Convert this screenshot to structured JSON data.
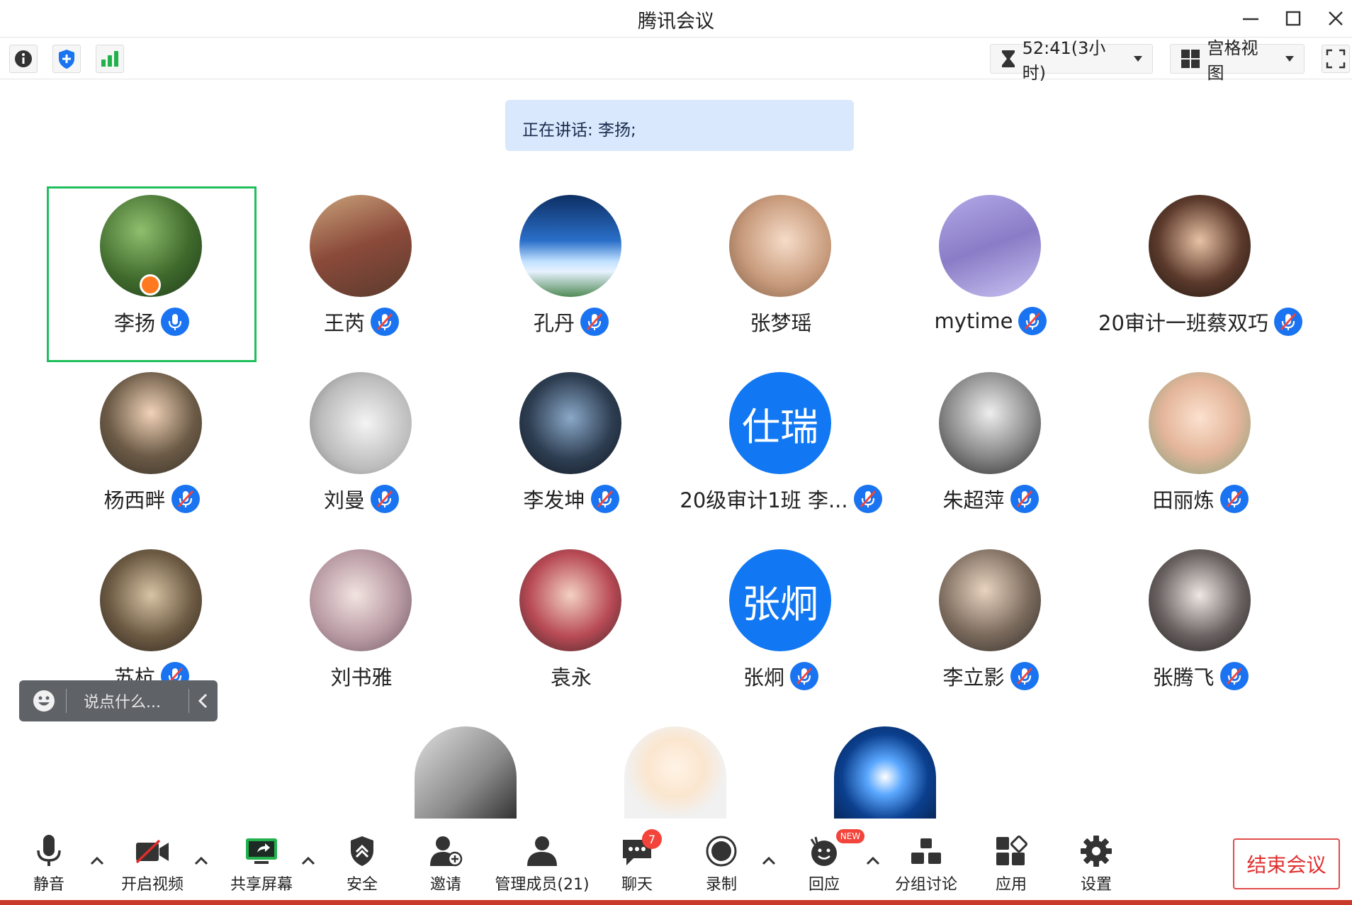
{
  "window": {
    "title": "腾讯会议"
  },
  "toolbar": {
    "timer": "52:41(3小时)",
    "view_mode": "宫格视图"
  },
  "speaking": {
    "text": "正在讲话: 李扬;"
  },
  "participants": [
    {
      "name": "李扬",
      "mic": "on",
      "host": true,
      "active": true
    },
    {
      "name": "王芮",
      "mic": "muted"
    },
    {
      "name": "孔丹",
      "mic": "muted"
    },
    {
      "name": "张梦瑶",
      "mic": "none"
    },
    {
      "name": "mytime",
      "mic": "muted"
    },
    {
      "name": "20审计一班蔡双巧",
      "mic": "muted"
    },
    {
      "name": "杨西畔",
      "mic": "muted"
    },
    {
      "name": "刘曼",
      "mic": "muted"
    },
    {
      "name": "李发坤",
      "mic": "muted"
    },
    {
      "name": "20级审计1班 李...",
      "mic": "muted",
      "avatar_text": "仕瑞"
    },
    {
      "name": "朱超萍",
      "mic": "muted"
    },
    {
      "name": "田丽炼",
      "mic": "muted"
    },
    {
      "name": "苏杭",
      "mic": "muted"
    },
    {
      "name": "刘书雅",
      "mic": "none"
    },
    {
      "name": "袁永",
      "mic": "none"
    },
    {
      "name": "张炯",
      "mic": "muted",
      "avatar_text": "张炯"
    },
    {
      "name": "李立影",
      "mic": "muted"
    },
    {
      "name": "张腾飞",
      "mic": "muted"
    }
  ],
  "chat": {
    "placeholder": "说点什么..."
  },
  "bottom": {
    "mute": "静音",
    "video": "开启视频",
    "share": "共享屏幕",
    "security": "安全",
    "invite": "邀请",
    "members": "管理成员(21)",
    "chat": "聊天",
    "chat_badge": "7",
    "record": "录制",
    "reaction": "回应",
    "reaction_badge": "NEW",
    "breakout": "分组讨论",
    "apps": "应用",
    "settings": "设置",
    "end": "结束会议"
  },
  "colors": {
    "accent": "#1a73f0",
    "active_border": "#1fbf5c",
    "end": "#e03030"
  }
}
